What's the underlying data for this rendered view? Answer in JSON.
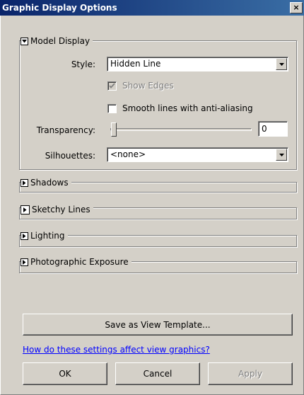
{
  "window": {
    "title": "Graphic Display Options",
    "close_glyph": "×"
  },
  "model_display": {
    "header": "Model Display",
    "expanded": true,
    "style_label": "Style:",
    "style_value": "Hidden Line",
    "show_edges_label": "Show Edges",
    "show_edges_checked": true,
    "show_edges_enabled": false,
    "smooth_lines_label": "Smooth lines with anti-aliasing",
    "smooth_lines_checked": false,
    "transparency_label": "Transparency:",
    "transparency_value": "0",
    "silhouettes_label": "Silhouettes:",
    "silhouettes_value": "<none>"
  },
  "sections": [
    {
      "label": "Shadows",
      "expanded": false
    },
    {
      "label": "Sketchy Lines",
      "expanded": false
    },
    {
      "label": "Lighting",
      "expanded": false
    },
    {
      "label": "Photographic Exposure",
      "expanded": false
    }
  ],
  "footer": {
    "save_template_label": "Save as View Template...",
    "help_link_label": "How do these settings affect view graphics?",
    "ok_label": "OK",
    "cancel_label": "Cancel",
    "apply_label": "Apply",
    "apply_enabled": false
  },
  "colors": {
    "dialog_bg": "#d4d0c8",
    "titlebar": "#0a246a",
    "link": "#0000ff",
    "disabled_text": "#808080"
  }
}
